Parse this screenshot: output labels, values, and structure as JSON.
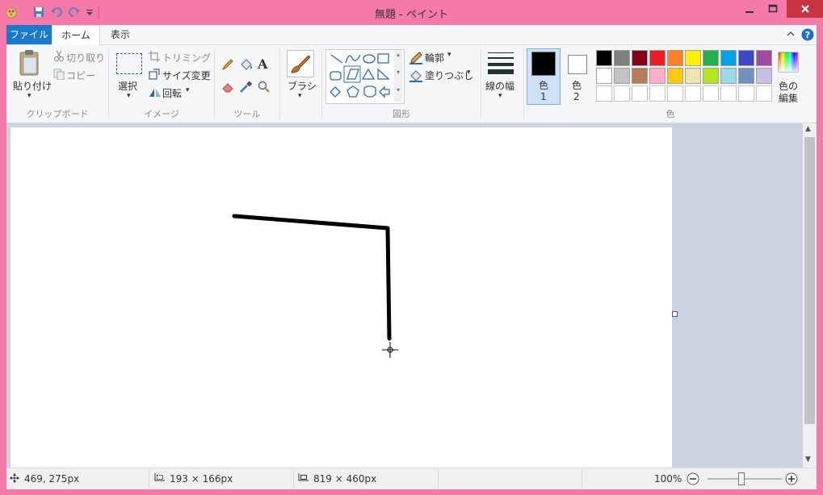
{
  "window": {
    "title": "無題 - ペイント"
  },
  "quick_access": {
    "save_icon": "save-icon",
    "undo_icon": "undo-icon",
    "redo_icon": "redo-icon"
  },
  "tabs": [
    {
      "label": "ファイル"
    },
    {
      "label": "ホーム"
    },
    {
      "label": "表示"
    }
  ],
  "clipboard": {
    "paste": "貼り付け",
    "cut": "切り取り",
    "copy": "コピー",
    "group": "クリップボード"
  },
  "image": {
    "select": "選択",
    "crop": "トリミング",
    "resize": "サイズ変更",
    "rotate": "回転",
    "group": "イメージ"
  },
  "tools": {
    "group": "ツール"
  },
  "brushes": {
    "label": "ブラシ"
  },
  "shapes": {
    "outline": "輪郭",
    "fill": "塗りつぶし",
    "group": "図形"
  },
  "size": {
    "label": "線の幅"
  },
  "colors": {
    "color1_label": "色",
    "color1_num": "1",
    "color2_label": "色",
    "color2_num": "2",
    "edit_label_1": "色の",
    "edit_label_2": "編集",
    "group": "色",
    "color1": "#000000",
    "color2": "#ffffff",
    "palette_row1": [
      "#000000",
      "#7f7f7f",
      "#880015",
      "#ed1c24",
      "#ff7f27",
      "#fff200",
      "#22b14c",
      "#00a2e8",
      "#3f48cc",
      "#a349a4"
    ],
    "palette_row2": [
      "#ffffff",
      "#c3c3c3",
      "#b97a57",
      "#ffaec9",
      "#ffc90e",
      "#efe4b0",
      "#b5e61d",
      "#99d9ea",
      "#7092be",
      "#c8bfe7"
    ]
  },
  "status": {
    "cursor_pos": "469, 275px",
    "selection_size": "193 × 166px",
    "canvas_size": "819 × 460px",
    "zoom": "100%"
  }
}
